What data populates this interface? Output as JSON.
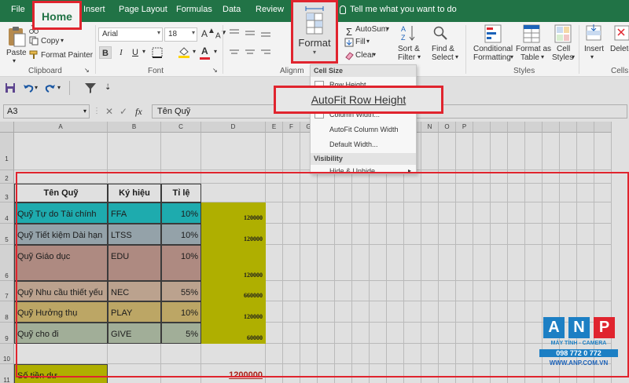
{
  "ribbon_tabs": {
    "file": "File",
    "home": "Home",
    "insert": "Insert",
    "page_layout": "Page Layout",
    "formulas": "Formulas",
    "data": "Data",
    "review": "Review",
    "tell_me": "Tell me what you want to do"
  },
  "clipboard": {
    "paste": "Paste",
    "copy": "Copy",
    "format_painter": "Format Painter",
    "label": "Clipboard"
  },
  "font": {
    "name": "Arial",
    "size": "18",
    "label": "Font",
    "bold": "B",
    "italic": "I",
    "underline": "U"
  },
  "alignment": {
    "label": "Alignm"
  },
  "editing": {
    "autosum": "AutoSum",
    "fill": "Fill",
    "clear": "Clear",
    "sort_filter": "Sort &",
    "sort_filter_2": "Filter",
    "find_select": "Find &",
    "find_select_2": "Select"
  },
  "styles": {
    "conditional": "Conditional",
    "conditional_2": "Formatting",
    "format_as": "Format as",
    "format_as_2": "Table",
    "cell_styles": "Cell",
    "cell_styles_2": "Styles",
    "label": "Styles"
  },
  "cells": {
    "insert": "Insert",
    "delete": "Delete",
    "format": "Format",
    "label": "Cells"
  },
  "format_menu": {
    "cell_size": "Cell Size",
    "row_height": "Row Height...",
    "autofit_row_height": "AutoFit Row Height",
    "column_width": "Column Width...",
    "autofit_column_width": "AutoFit Column Width",
    "default_width": "Default Width...",
    "visibility": "Visibility",
    "hide_unhide": "Hide & Unhide"
  },
  "formula_bar": {
    "name_box": "A3",
    "fx": "fx",
    "value": "Tên Quỹ"
  },
  "columns": [
    "A",
    "B",
    "C",
    "D",
    "E",
    "F",
    "G",
    "H",
    "I",
    "J",
    "K",
    "L",
    "M",
    "N",
    "O",
    "P"
  ],
  "rows": [
    "1",
    "2",
    "3",
    "4",
    "5",
    "6",
    "7",
    "8",
    "9",
    "10",
    "11"
  ],
  "table": {
    "headers": {
      "name": "Tên Quỹ",
      "code": "Ký hiệu",
      "rate": "Tỉ lệ"
    },
    "funds": [
      {
        "name": "Quỹ Tự do Tài chính",
        "code": "FFA",
        "rate": "10%",
        "amount": "120000",
        "color": "#23c3c6"
      },
      {
        "name": "Quỹ Tiết kiệm Dài hạn",
        "code": "LTSS",
        "rate": "10%",
        "amount": "120000",
        "color": "#a9b9c1"
      },
      {
        "name": "Quỹ Giáo dục",
        "code": "EDU",
        "rate": "10%",
        "amount": "120000",
        "color": "#c69e93"
      },
      {
        "name": "Quỹ Nhu cầu thiết yếu",
        "code": "NEC",
        "rate": "55%",
        "amount": "660000",
        "color": "#d5b9a2"
      },
      {
        "name": "Quỹ Hưởng thụ",
        "code": "PLAY",
        "rate": "10%",
        "amount": "120000",
        "color": "#d6bd74"
      },
      {
        "name": "Quỹ cho đi",
        "code": "GIVE",
        "rate": "5%",
        "amount": "60000",
        "color": "#b8c6ad"
      }
    ],
    "total_label": "Số tiền dư",
    "total_value": "1200000"
  },
  "colors": {
    "excel_green": "#217346",
    "highlight_red": "#e0242e",
    "amount_fill": "#c8c800",
    "total_label_fill": "#c8c800",
    "total_value_color": "#c0281e"
  },
  "watermark": {
    "letters": [
      "A",
      "N",
      "P"
    ],
    "line1": "MÁY TÍNH - CAMERA",
    "line2": "098 772 0 772",
    "line3": "WWW.ANP.COM.VN"
  }
}
